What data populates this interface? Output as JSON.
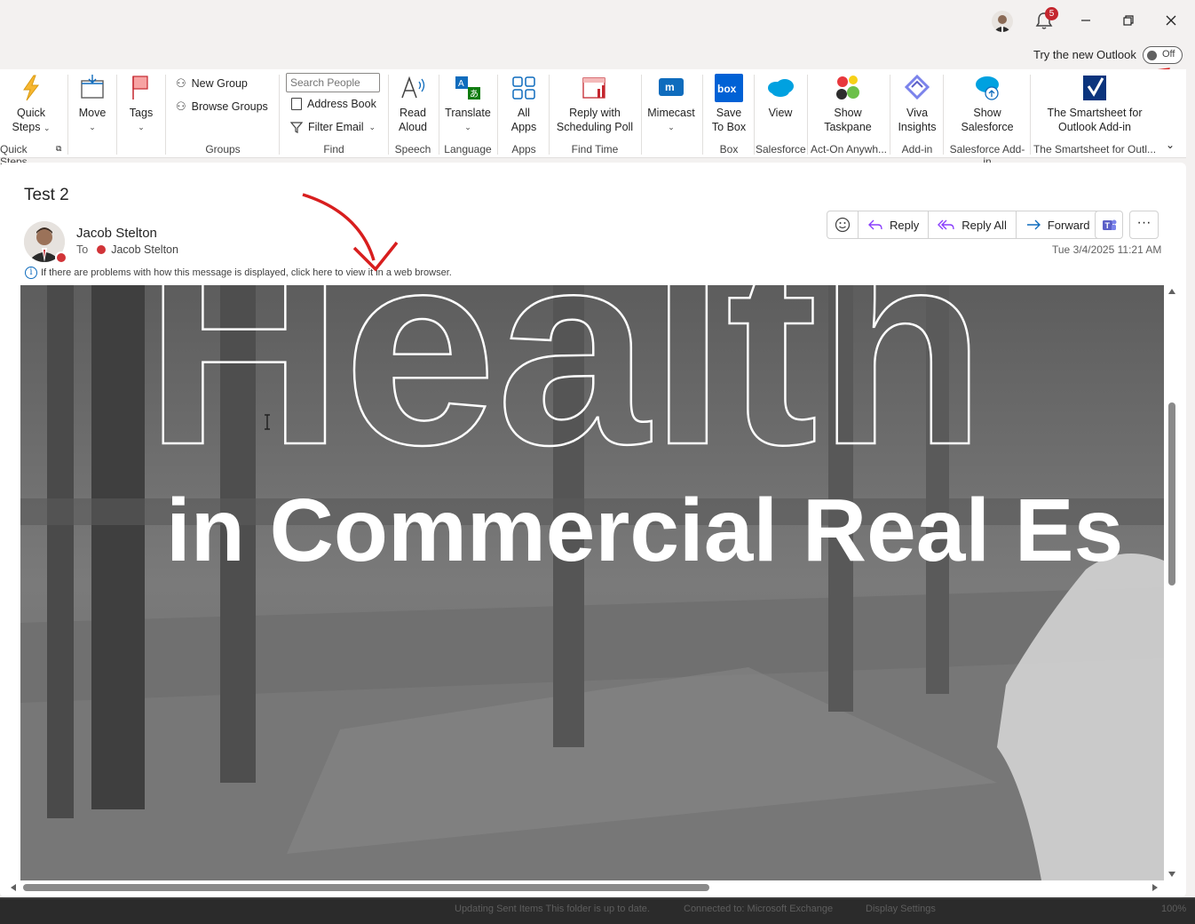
{
  "titlebar": {
    "notification_count": "5",
    "try_new_outlook": "Try the new Outlook",
    "toggle_state": "Off"
  },
  "ribbon": {
    "quick_steps": {
      "label1": "Quick",
      "label2": "Steps",
      "group": "Quick Steps"
    },
    "move": {
      "label": "Move"
    },
    "tags": {
      "label": "Tags"
    },
    "groups": {
      "new_group": "New Group",
      "browse_groups": "Browse Groups",
      "group": "Groups"
    },
    "find": {
      "search_placeholder": "Search People",
      "address_book": "Address Book",
      "filter_email": "Filter Email",
      "group": "Find"
    },
    "speech": {
      "label1": "Read",
      "label2": "Aloud",
      "group": "Speech"
    },
    "language": {
      "label": "Translate",
      "group": "Language"
    },
    "apps": {
      "label1": "All",
      "label2": "Apps",
      "group": "Apps"
    },
    "find_time": {
      "label1": "Reply with",
      "label2": "Scheduling Poll",
      "group": "Find Time"
    },
    "mimecast": {
      "label": "Mimecast"
    },
    "box": {
      "label1": "Save",
      "label2": "To Box",
      "group": "Box"
    },
    "salesforce": {
      "label": "View",
      "group": "Salesforce"
    },
    "acton": {
      "label1": "Show",
      "label2": "Taskpane",
      "group": "Act-On Anywh..."
    },
    "viva": {
      "label1": "Viva",
      "label2": "Insights",
      "group": "Add-in"
    },
    "show_salesforce": {
      "label1": "Show",
      "label2": "Salesforce",
      "group": "Salesforce Add-in"
    },
    "smartsheet": {
      "label1": "The Smartsheet for",
      "label2": "Outlook Add-in",
      "group": "The Smartsheet for Outl..."
    }
  },
  "message": {
    "subject": "Test 2",
    "sender": "Jacob Stelton",
    "to_label": "To",
    "recipient": "Jacob Stelton",
    "info": "If there are problems with how this message is displayed, click here to view it in a web browser.",
    "date": "Tue 3/4/2025 11:21 AM",
    "actions": {
      "reply": "Reply",
      "reply_all": "Reply All",
      "forward": "Forward"
    }
  },
  "email_image": {
    "headline_outline": "Health",
    "headline_bold": "in Commercial Real Es"
  },
  "statusbar": {
    "updating": "Updating Sent Items   This folder is up to date.",
    "connected": "Connected to: Microsoft Exchange",
    "display_settings": "Display Settings",
    "zoom": "100%"
  }
}
